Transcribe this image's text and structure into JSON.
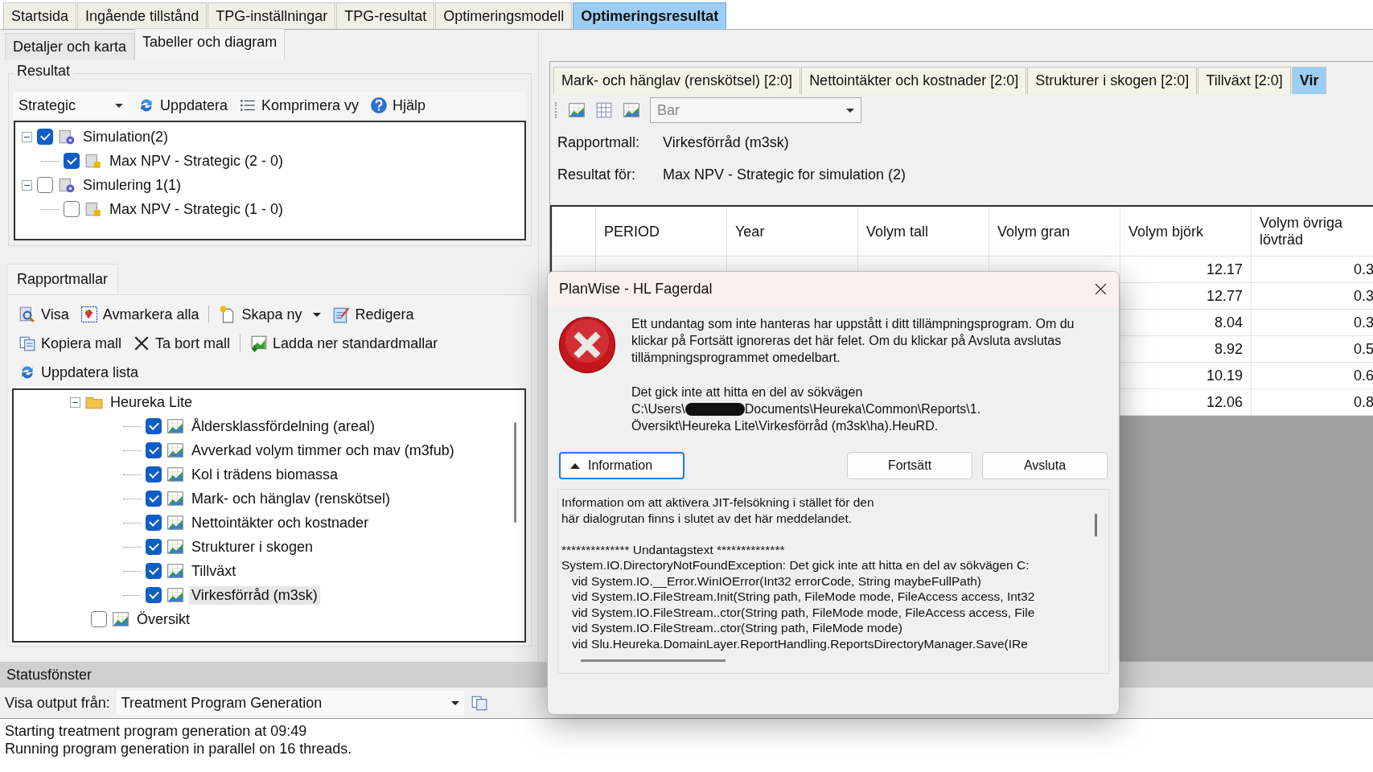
{
  "main_tabs": [
    {
      "label": "Startsida",
      "selected": false
    },
    {
      "label": "Ingående tillstånd",
      "selected": false
    },
    {
      "label": "TPG-inställningar",
      "selected": false
    },
    {
      "label": "TPG-resultat",
      "selected": false
    },
    {
      "label": "Optimeringsmodell",
      "selected": false
    },
    {
      "label": "Optimeringsresultat",
      "selected": true
    }
  ],
  "sub_tabs": [
    {
      "label": "Detaljer och karta",
      "selected": false
    },
    {
      "label": "Tabeller och diagram",
      "selected": true
    }
  ],
  "results": {
    "title": "Resultat",
    "view": "Strategic",
    "toolbar": [
      {
        "kind": "refresh",
        "label": "Uppdatera"
      },
      {
        "kind": "list",
        "label": "Komprimera vy"
      },
      {
        "kind": "help",
        "label": "Hjälp"
      }
    ],
    "tree": [
      {
        "label": "Simulation(2)",
        "checked": true,
        "expanded": true,
        "children": [
          {
            "label": "Max NPV - Strategic (2 - 0)",
            "checked": true
          }
        ]
      },
      {
        "label": "Simulering 1(1)",
        "checked": false,
        "expanded": true,
        "children": [
          {
            "label": "Max NPV - Strategic (1 - 0)",
            "checked": false
          }
        ]
      }
    ]
  },
  "templates": {
    "tab": "Rapportmallar",
    "toolbar_rows": [
      [
        {
          "kind": "view",
          "label": "Visa"
        },
        {
          "kind": "unmark",
          "label": "Avmarkera alla"
        },
        {
          "kind": "sep"
        },
        {
          "kind": "new",
          "label": "Skapa ny"
        },
        {
          "kind": "edit",
          "label": "Redigera"
        }
      ],
      [
        {
          "kind": "copy",
          "label": "Kopiera mall"
        },
        {
          "kind": "delete",
          "label": "Ta bort mall"
        },
        {
          "kind": "sep"
        },
        {
          "kind": "download",
          "label": "Ladda ner standardmallar"
        }
      ],
      [
        {
          "kind": "refresh",
          "label": "Uppdatera lista"
        }
      ]
    ],
    "folder": {
      "label": "Heureka Lite",
      "expanded": true,
      "children": [
        {
          "label": "Åldersklassfördelning (areal)",
          "checked": true,
          "selected": false
        },
        {
          "label": "Avverkad volym timmer och mav (m3fub)",
          "checked": true,
          "selected": false
        },
        {
          "label": "Kol i trädens biomassa",
          "checked": true,
          "selected": false
        },
        {
          "label": "Mark- och hänglav (renskötsel)",
          "checked": true,
          "selected": false
        },
        {
          "label": "Nettointäkter och kostnader",
          "checked": true,
          "selected": false
        },
        {
          "label": "Strukturer i skogen",
          "checked": true,
          "selected": false
        },
        {
          "label": "Tillväxt",
          "checked": true,
          "selected": false
        },
        {
          "label": "Virkesförråd (m3sk)",
          "checked": true,
          "selected": true
        }
      ]
    },
    "sibling": {
      "label": "Översikt",
      "checked": false
    }
  },
  "report": {
    "tabs": [
      {
        "label": "Mark- och hänglav (renskötsel) [2:0]",
        "selected": false
      },
      {
        "label": "Nettointäkter och kostnader [2:0]",
        "selected": false
      },
      {
        "label": "Strukturer i skogen [2:0]",
        "selected": false
      },
      {
        "label": "Tillväxt [2:0]",
        "selected": false
      },
      {
        "label": "Vir",
        "selected": true
      }
    ],
    "chart_type": "Bar",
    "info": [
      {
        "label": "Rapportmall:",
        "value": "Virkesförråd (m3sk)"
      },
      {
        "label": "Resultat för:",
        "value": "Max NPV - Strategic for simulation (2)"
      }
    ],
    "columns": [
      "PERIOD",
      "Year",
      "Volym tall",
      "Volym gran",
      "Volym björk",
      "Volym övriga lövträd"
    ],
    "rows": [
      [
        "12.17",
        "0.3"
      ],
      [
        "12.77",
        "0.3"
      ],
      [
        "8.04",
        "0.3"
      ],
      [
        "8.92",
        "0.5"
      ],
      [
        "10.19",
        "0.6"
      ],
      [
        "12.06",
        "0.8"
      ]
    ]
  },
  "dialog": {
    "title": "PlanWise - HL Fagerdal",
    "message": "Ett undantag som inte hanteras har uppstått i ditt tillämpningsprogram. Om du klickar på Fortsätt ignoreras det här felet. Om du klickar på Avsluta avslutas tillämpningsprogrammet omedelbart.",
    "path_intro": "Det gick inte att hitta en del av sökvägen",
    "path_start": "C:\\Users\\",
    "path_end": "Documents\\Heureka\\Common\\Reports\\1.",
    "path_tail": "Översikt\\Heureka Lite\\Virkesförråd (m3sk\\ha).HeuRD.",
    "details_button": {
      "label": "Information",
      "expanded": true
    },
    "buttons": [
      "Fortsätt",
      "Avsluta"
    ],
    "details_intro": [
      "Information om att aktivera JIT-felsökning i stället för den",
      "här dialogrutan finns i slutet av det här meddelandet."
    ],
    "details": [
      "************** Undantagstext **************",
      "System.IO.DirectoryNotFoundException: Det gick inte att hitta en del av sökvägen C:",
      "   vid System.IO.__Error.WinIOError(Int32 errorCode, String maybeFullPath)",
      "   vid System.IO.FileStream.Init(String path, FileMode mode, FileAccess access, Int32",
      "   vid System.IO.FileStream..ctor(String path, FileMode mode, FileAccess access, File",
      "   vid System.IO.FileStream..ctor(String path, FileMode mode)",
      "   vid Slu.Heureka.DomainLayer.ReportHandling.ReportsDirectoryManager.Save(IRe"
    ]
  },
  "status": {
    "title": "Statusfönster",
    "output_label": "Visa output från:",
    "output_source": "Treatment Program Generation",
    "log": [
      "Starting treatment program generation at 09:49",
      "Running program generation in parallel on 16 threads."
    ]
  }
}
